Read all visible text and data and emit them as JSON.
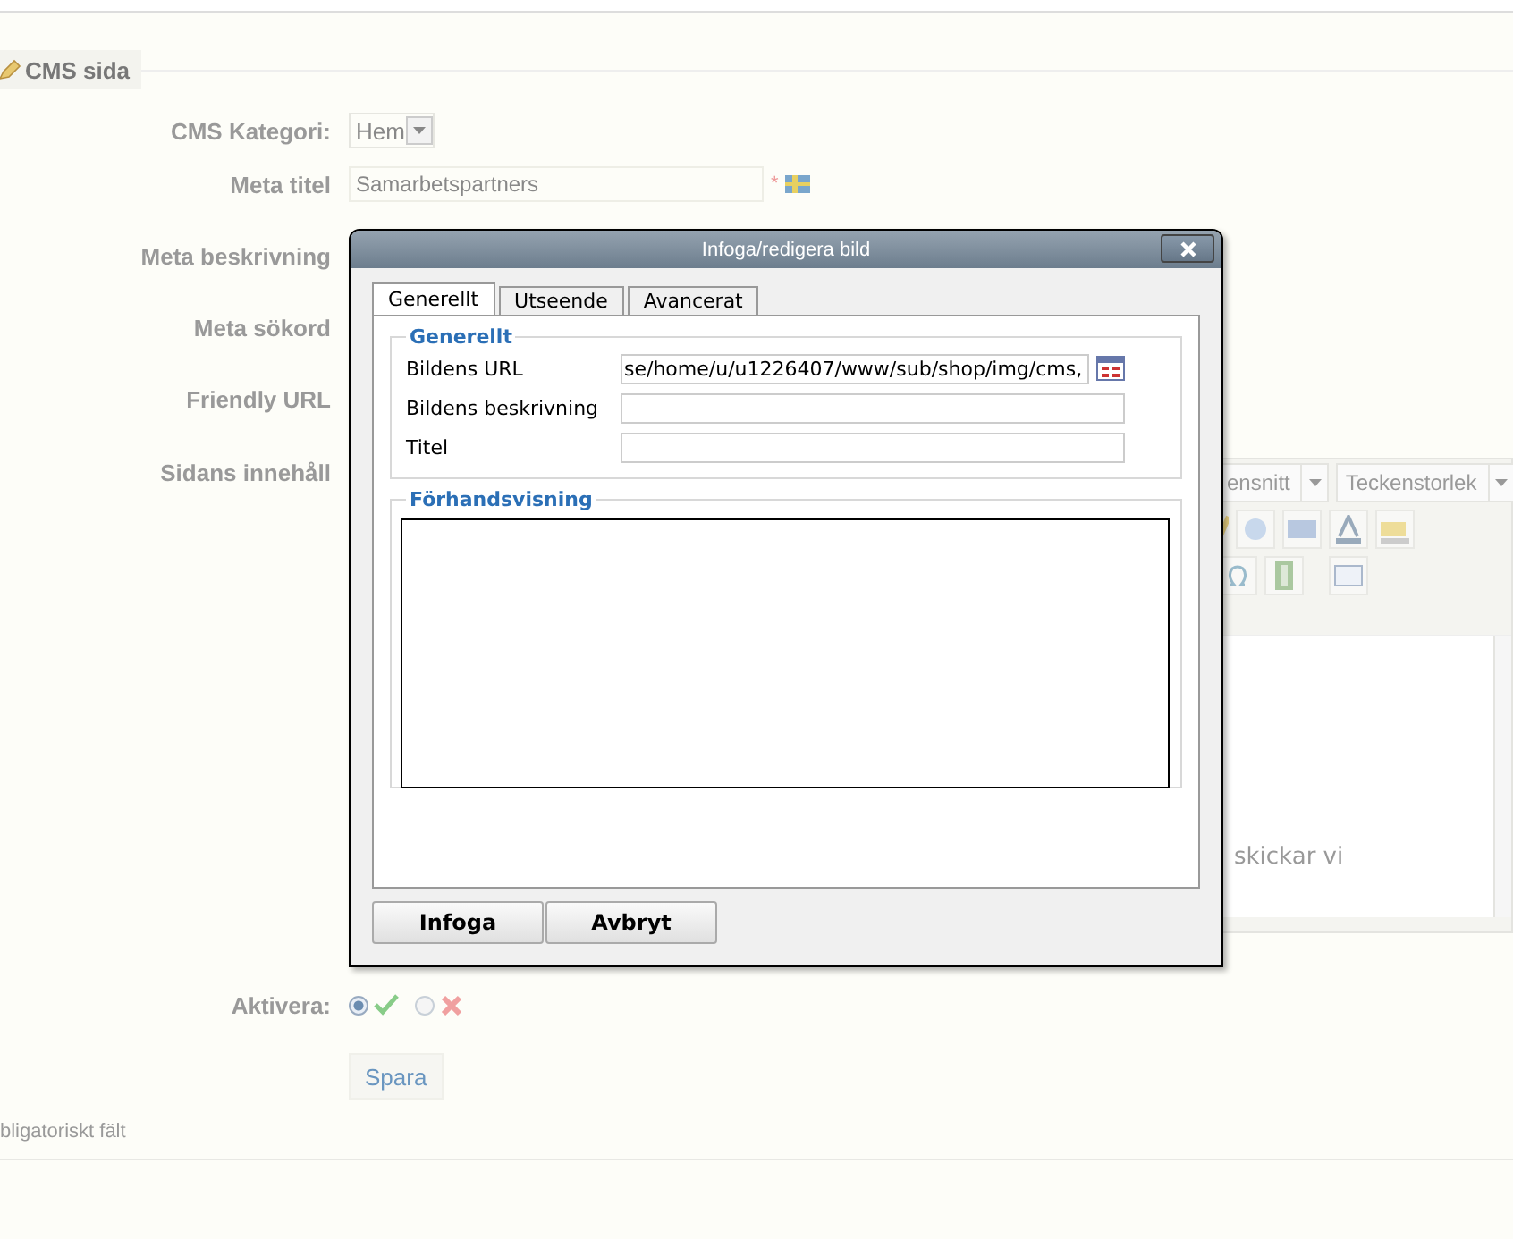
{
  "page": {
    "legend": "CMS sida",
    "fields": [
      {
        "label": "CMS Kategori:",
        "kind": "select",
        "value": "Hem"
      },
      {
        "label": "Meta titel",
        "kind": "text",
        "value": "Samarbetspartners",
        "required_mark": "*",
        "translatable": true
      },
      {
        "label": "Meta beskrivning",
        "kind": "covered"
      },
      {
        "label": "Meta sökord",
        "kind": "covered"
      },
      {
        "label": "Friendly URL",
        "kind": "covered"
      },
      {
        "label": "Sidans innehåll",
        "kind": "editor"
      }
    ],
    "editor": {
      "dropdowns": [
        "ensnitt",
        "Teckenstorlek"
      ],
      "text": "skickar vi"
    },
    "activate": {
      "label": "Aktivera:",
      "options": [
        {
          "kind": "yes",
          "selected": true
        },
        {
          "kind": "no",
          "selected": false
        }
      ]
    },
    "save_button": "Spara",
    "footnote": "bligatoriskt fält"
  },
  "dialog": {
    "title": "Infoga/redigera bild",
    "tabs": [
      {
        "label": "Generellt",
        "selected": true
      },
      {
        "label": "Utseende",
        "selected": false
      },
      {
        "label": "Avancerat",
        "selected": false
      }
    ],
    "general": {
      "legend": "Generellt",
      "fields": [
        {
          "label": "Bildens URL",
          "value": "se/home/u/u1226407/www/sub/shop/img/cms,",
          "browse": true
        },
        {
          "label": "Bildens beskrivning"
        },
        {
          "label": "Titel"
        }
      ]
    },
    "preview": {
      "legend": "Förhandsvisning"
    },
    "buttons": [
      "Infoga",
      "Avbryt"
    ]
  }
}
